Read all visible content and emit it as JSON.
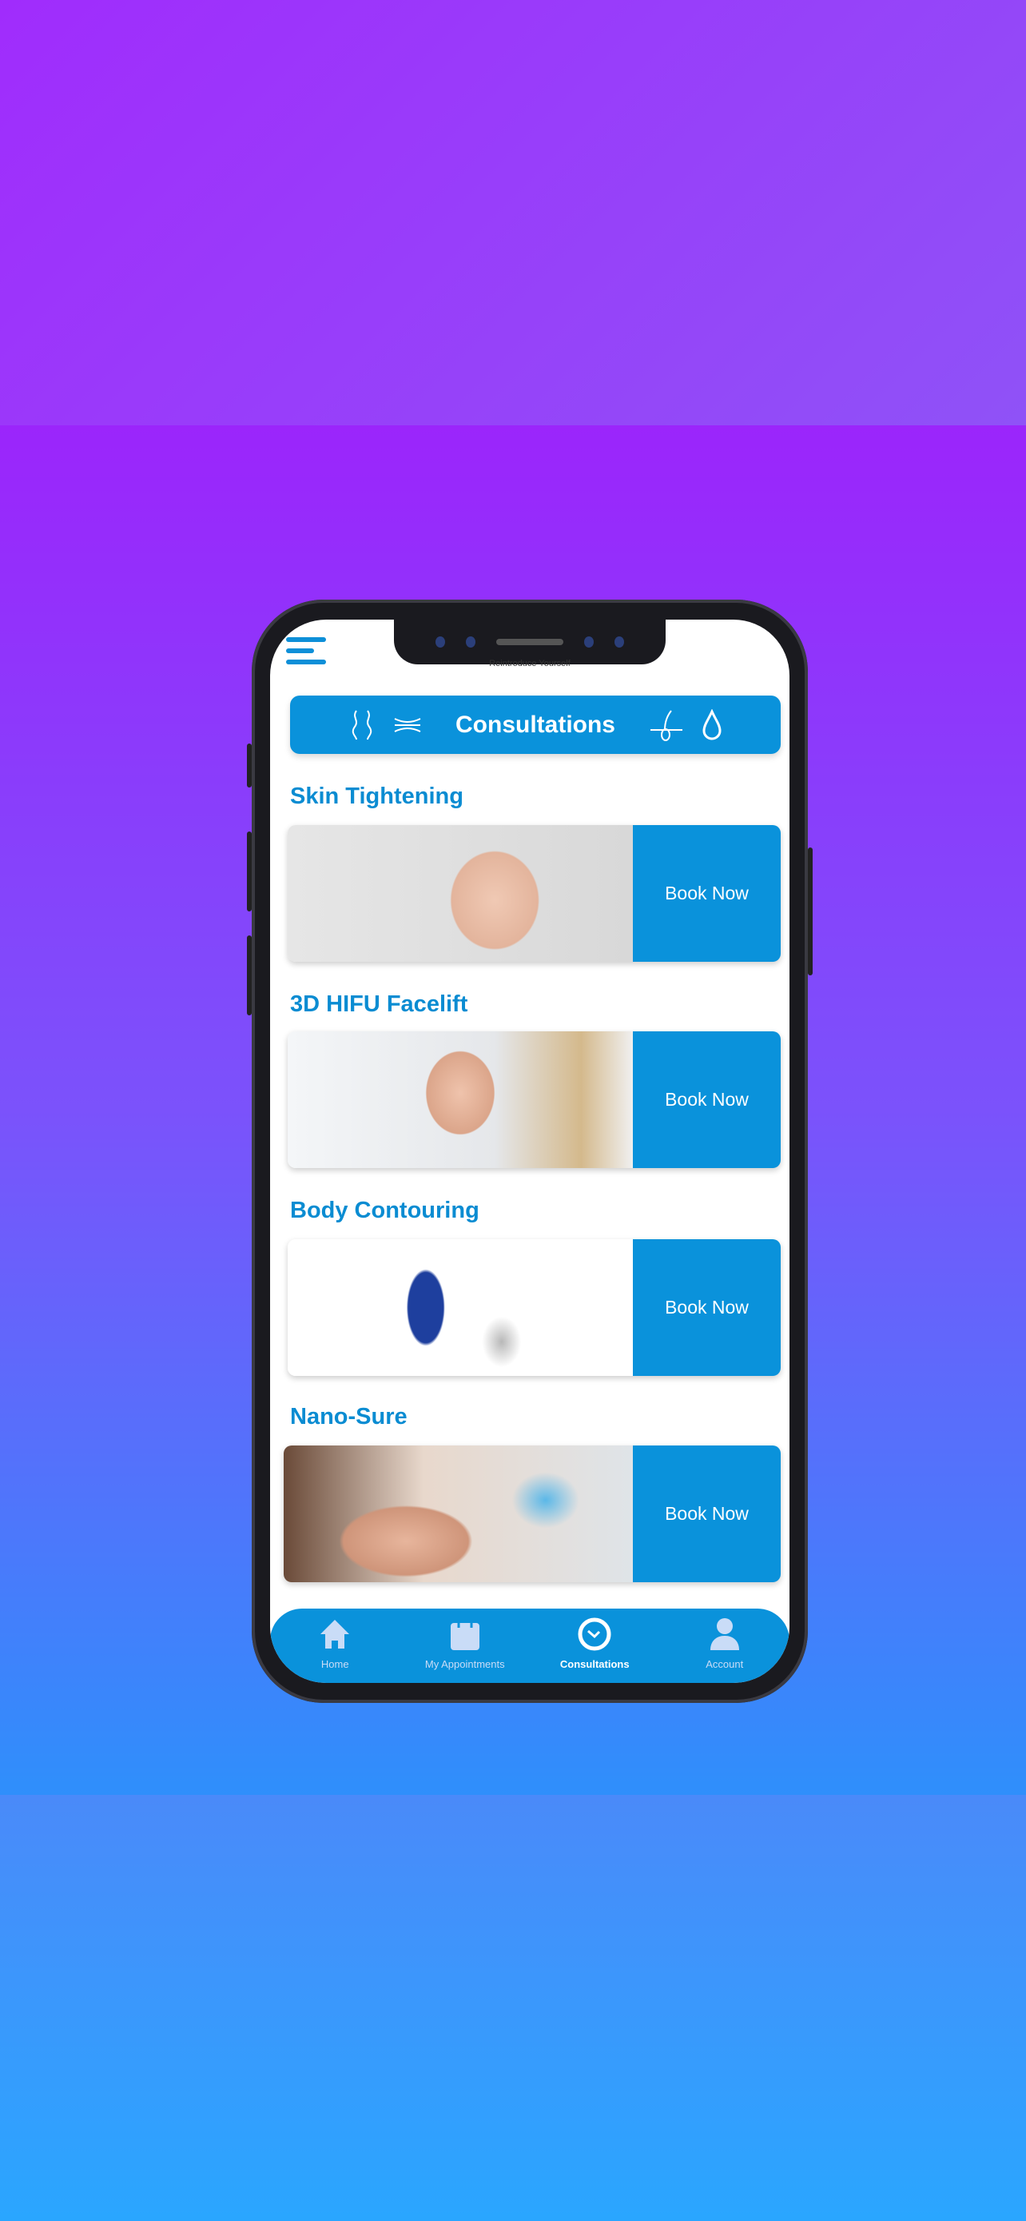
{
  "app": {
    "tagline": "Reintroduce Yourself"
  },
  "header": {
    "title": "Consultations",
    "icons": [
      "body-contour-icon",
      "compress-icon",
      "hair-follicle-icon",
      "droplet-icon"
    ]
  },
  "services": [
    {
      "title": "Skin Tightening",
      "button": "Book Now"
    },
    {
      "title": "3D HIFU Facelift",
      "button": "Book Now"
    },
    {
      "title": "Body Contouring",
      "button": "Book Now"
    },
    {
      "title": "Nano-Sure",
      "button": "Book Now"
    }
  ],
  "nav": {
    "items": [
      {
        "label": "Home",
        "icon": "home-icon"
      },
      {
        "label": "My Appointments",
        "icon": "calendar-icon"
      },
      {
        "label": "Consultations",
        "icon": "clock-icon",
        "active": true
      },
      {
        "label": "Account",
        "icon": "user-icon"
      }
    ]
  },
  "colors": {
    "accent": "#0a92db",
    "title": "#0a8cd2"
  }
}
